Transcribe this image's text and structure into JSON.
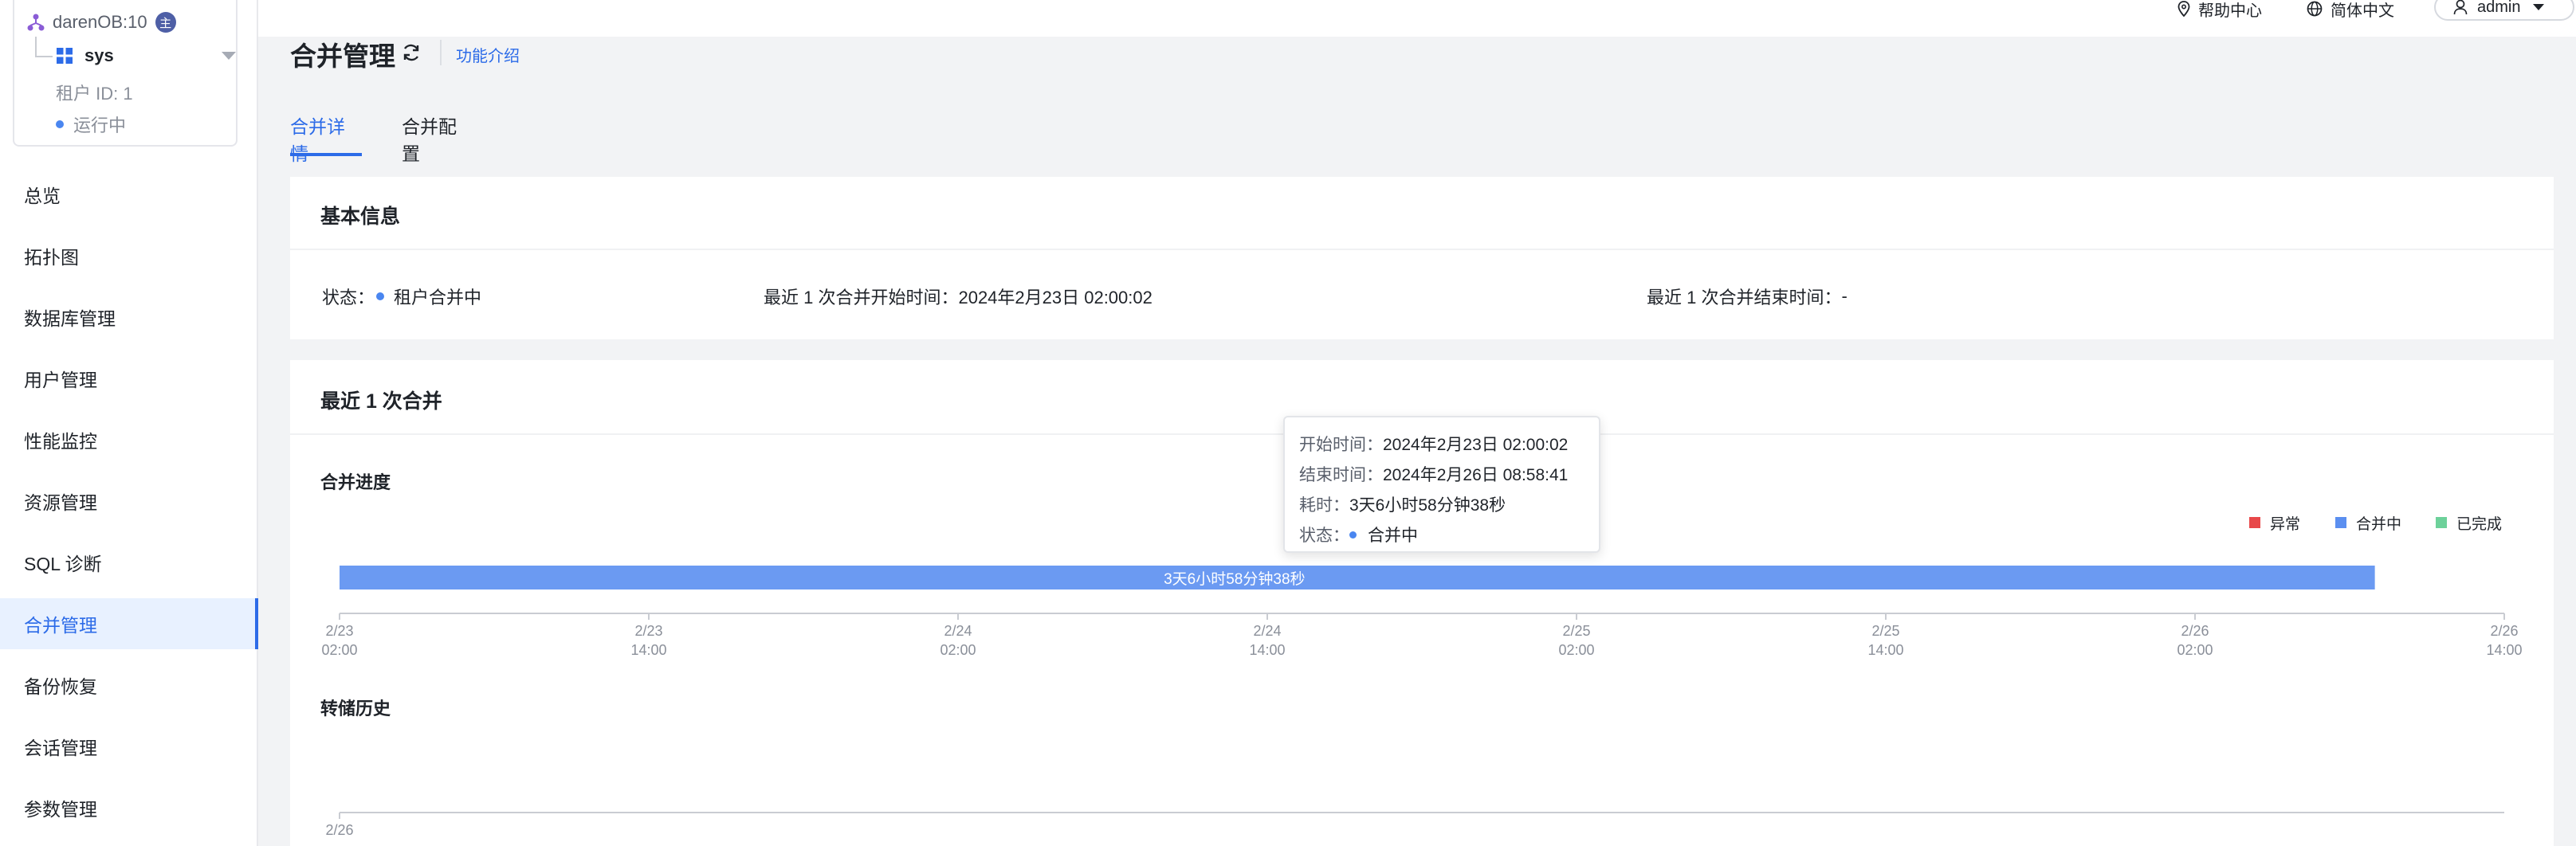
{
  "sidebar": {
    "cluster": {
      "name": "darenOB:10",
      "role_badge": "主"
    },
    "tenant": {
      "name": "sys",
      "id_text": "租户 ID: 1",
      "status": "运行中"
    },
    "items": [
      {
        "label": "总览",
        "active": false
      },
      {
        "label": "拓扑图",
        "active": false
      },
      {
        "label": "数据库管理",
        "active": false
      },
      {
        "label": "用户管理",
        "active": false
      },
      {
        "label": "性能监控",
        "active": false
      },
      {
        "label": "资源管理",
        "active": false
      },
      {
        "label": "SQL 诊断",
        "active": false
      },
      {
        "label": "合并管理",
        "active": true
      },
      {
        "label": "备份恢复",
        "active": false
      },
      {
        "label": "会话管理",
        "active": false
      },
      {
        "label": "参数管理",
        "active": false
      }
    ]
  },
  "topbar": {
    "help": "帮助中心",
    "language": "简体中文",
    "user": "admin"
  },
  "page": {
    "title": "合并管理",
    "intro_link": "功能介绍",
    "tabs": [
      {
        "label": "合并详情",
        "active": true
      },
      {
        "label": "合并配置",
        "active": false
      }
    ]
  },
  "basic_info": {
    "title": "基本信息",
    "status_label": "状态：",
    "status_value": "租户合并中",
    "last_start_label": "最近 1 次合并开始时间：",
    "last_start_value": "2024年2月23日 02:00:02",
    "last_end_label": "最近 1 次合并结束时间：",
    "last_end_value": "-"
  },
  "last_merge": {
    "title": "最近 1 次合并",
    "progress_label": "合并进度",
    "history_label": "转储历史",
    "legend": [
      {
        "label": "异常",
        "color": "#e8484a"
      },
      {
        "label": "合并中",
        "color": "#5b8ff0"
      },
      {
        "label": "已完成",
        "color": "#6dd19a"
      }
    ],
    "tooltip": {
      "start_label": "开始时间：",
      "start_value": "2024年2月23日 02:00:02",
      "end_label": "结束时间：",
      "end_value": "2024年2月26日 08:58:41",
      "duration_label": "耗时：",
      "duration_value": "3天6小时58分钟38秒",
      "status_label": "状态：",
      "status_value": "合并中"
    }
  },
  "chart_data": [
    {
      "type": "bar",
      "orientation": "horizontal-timeline",
      "series": [
        {
          "name": "合并中",
          "start": "2024-02-23 02:00:02",
          "end": "2024-02-26 08:58:41",
          "label": "3天6小时58分钟38秒",
          "color": "#6b9af2"
        }
      ],
      "x_ticks": [
        {
          "date": "2/23",
          "time": "02:00"
        },
        {
          "date": "2/23",
          "time": "14:00"
        },
        {
          "date": "2/24",
          "time": "02:00"
        },
        {
          "date": "2/24",
          "time": "14:00"
        },
        {
          "date": "2/25",
          "time": "02:00"
        },
        {
          "date": "2/25",
          "time": "14:00"
        },
        {
          "date": "2/26",
          "time": "02:00"
        },
        {
          "date": "2/26",
          "time": "14:00"
        }
      ],
      "xlim": [
        "2024-02-23 02:00",
        "2024-02-26 14:00"
      ],
      "legend_position": "top-right",
      "grid": false
    },
    {
      "type": "bar",
      "orientation": "horizontal-timeline",
      "series": [],
      "x_ticks": [
        {
          "date": "2/26",
          "time": ""
        }
      ],
      "grid": false
    }
  ]
}
